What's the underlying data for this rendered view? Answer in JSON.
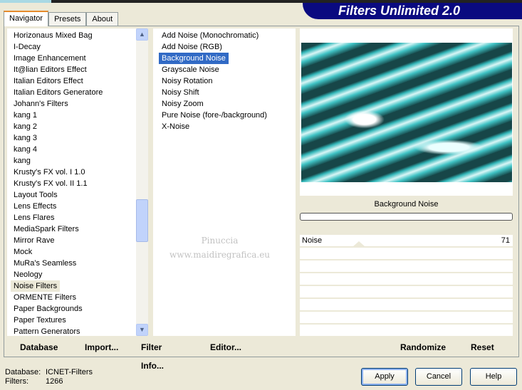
{
  "title": "Filters Unlimited 2.0",
  "tabs": [
    "Navigator",
    "Presets",
    "About"
  ],
  "categories": [
    "Horizonaus Mixed Bag",
    "I-Decay",
    "Image Enhancement",
    "It@lian Editors Effect",
    "Italian Editors Effect",
    "Italian Editors Generatore",
    "Johann's Filters",
    "kang 1",
    "kang 2",
    "kang 3",
    "kang 4",
    "kang",
    "Krusty's FX vol. I 1.0",
    "Krusty's FX vol. II 1.1",
    "Layout Tools",
    "Lens Effects",
    "Lens Flares",
    "MediaSpark Filters",
    "Mirror Rave",
    "Mock",
    "MuRa's Seamless",
    "Neology",
    "Noise Filters",
    "ORMENTE Filters",
    "Paper Backgrounds",
    "Paper Textures",
    "Pattern Generators"
  ],
  "selected_category": "Noise Filters",
  "filters": [
    "Add Noise (Monochromatic)",
    "Add Noise (RGB)",
    "Background Noise",
    "Grayscale Noise",
    "Noisy Rotation",
    "Noisy Shift",
    "Noisy Zoom",
    "Pure Noise (fore-/background)",
    "X-Noise"
  ],
  "selected_filter": "Background Noise",
  "preview_title": "Background Noise",
  "params": [
    {
      "label": "Noise",
      "value": "71",
      "fraction": 0.278
    }
  ],
  "watermark": [
    "Pinuccia",
    "www.maidiregrafica.eu"
  ],
  "buttons": {
    "database": "Database",
    "import": "Import...",
    "filter_info": "Filter Info...",
    "editor": "Editor...",
    "randomize": "Randomize",
    "reset": "Reset",
    "apply": "Apply",
    "cancel": "Cancel",
    "help": "Help"
  },
  "status": {
    "database_label": "Database:",
    "database_value": "ICNET-Filters",
    "filters_label": "Filters:",
    "filters_value": "1266"
  }
}
